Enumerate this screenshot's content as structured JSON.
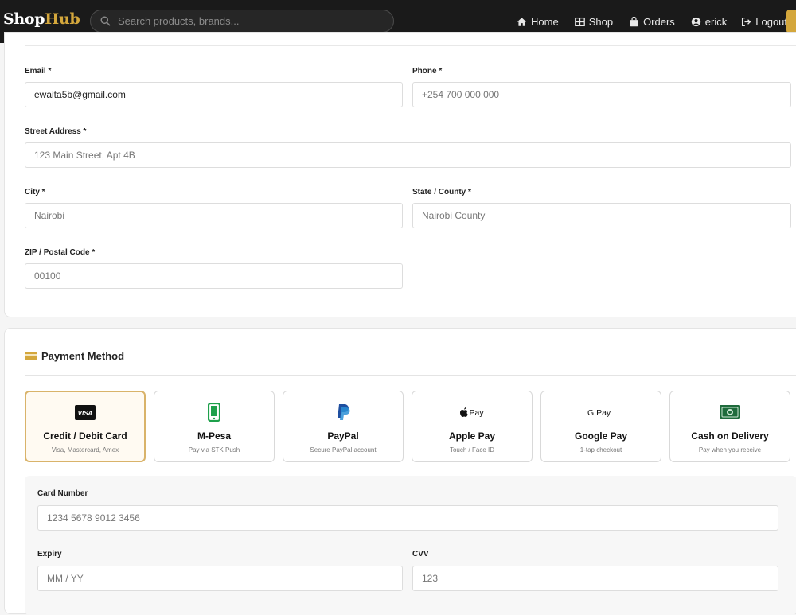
{
  "nav": {
    "brand_part1": "Shop",
    "brand_part2": "Hub",
    "search_placeholder": "Search products, brands...",
    "links": [
      {
        "label": "Home",
        "icon": "home-icon"
      },
      {
        "label": "Shop",
        "icon": "grid-icon"
      },
      {
        "label": "Orders",
        "icon": "bag-icon"
      },
      {
        "label": "erick",
        "icon": "user-icon"
      },
      {
        "label": "Logout",
        "icon": "logout-icon"
      }
    ]
  },
  "address": {
    "email_label": "Email *",
    "email_value": "ewaita5b@gmail.com",
    "phone_label": "Phone *",
    "phone_placeholder": "+254 700 000 000",
    "street_label": "Street Address *",
    "street_placeholder": "123 Main Street, Apt 4B",
    "city_label": "City *",
    "city_placeholder": "Nairobi",
    "state_label": "State / County *",
    "state_placeholder": "Nairobi County",
    "zip_label": "ZIP / Postal Code *",
    "zip_placeholder": "00100"
  },
  "payment": {
    "title": "Payment Method",
    "options": [
      {
        "title": "Credit / Debit Card",
        "subtitle": "Visa, Mastercard, Amex",
        "icon": "visa-icon",
        "icon_text": "VISA",
        "selected": true
      },
      {
        "title": "M-Pesa",
        "subtitle": "Pay via STK Push",
        "icon": "mobile-phone-icon",
        "selected": false
      },
      {
        "title": "PayPal",
        "subtitle": "Secure PayPal account",
        "icon": "paypal-icon",
        "selected": false
      },
      {
        "title": "Apple Pay",
        "subtitle": "Touch / Face ID",
        "icon": "apple-pay-icon",
        "icon_text": "Pay",
        "selected": false
      },
      {
        "title": "Google Pay",
        "subtitle": "1-tap checkout",
        "icon": "google-pay-icon",
        "icon_text": "G Pay",
        "selected": false
      },
      {
        "title": "Cash on Delivery",
        "subtitle": "Pay when you receive",
        "icon": "cash-icon",
        "selected": false
      }
    ],
    "card_number_label": "Card Number",
    "card_number_placeholder": "1234 5678 9012 3456",
    "expiry_label": "Expiry",
    "expiry_placeholder": "MM / YY",
    "cvv_label": "CVV",
    "cvv_placeholder": "123"
  },
  "colors": {
    "accent": "#d4a73c",
    "navbar_bg": "#1a1a1a",
    "selected_border": "#d9b36a",
    "mpesa_green": "#1ea04b",
    "paypal_blue": "#1f4fa0",
    "cash_green": "#1f6b3c"
  }
}
